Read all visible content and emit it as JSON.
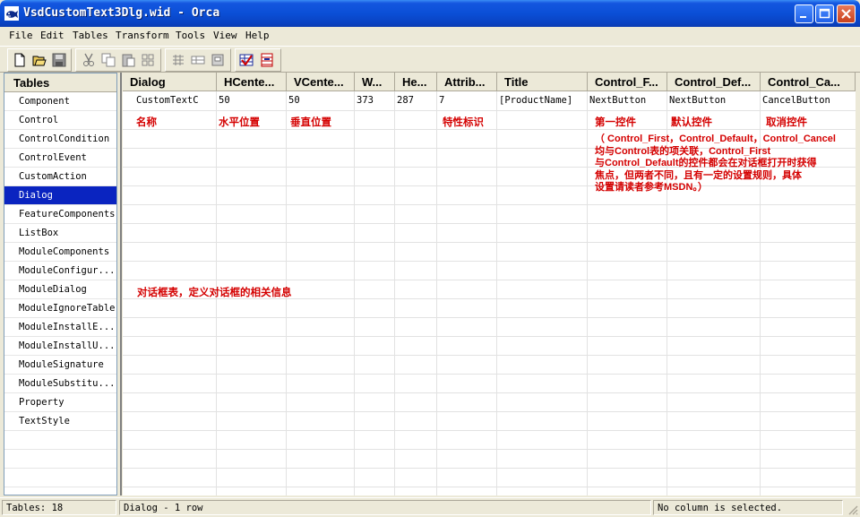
{
  "window": {
    "title": "VsdCustomText3Dlg.wid - Orca",
    "app_icon": "orca-whale-icon",
    "controls": [
      "minimize-icon",
      "maximize-icon",
      "close-icon"
    ]
  },
  "menu": {
    "items": [
      "File",
      "Edit",
      "Tables",
      "Transform",
      "Tools",
      "View",
      "Help"
    ]
  },
  "toolbar": {
    "icons": [
      "new-icon",
      "open-icon",
      "save-icon",
      "cut-icon",
      "copy-icon",
      "paste-icon",
      "find-icon",
      "add-row-icon",
      "drop-row-icon",
      "add-table-icon",
      "validate-icon",
      "merge-module-icon"
    ]
  },
  "sidebar": {
    "header": "Tables",
    "items": [
      "Component",
      "Control",
      "ControlCondition",
      "ControlEvent",
      "CustomAction",
      "Dialog",
      "FeatureComponents",
      "ListBox",
      "ModuleComponents",
      "ModuleConfigur...",
      "ModuleDialog",
      "ModuleIgnoreTable",
      "ModuleInstallE...",
      "ModuleInstallU...",
      "ModuleSignature",
      "ModuleSubstitu...",
      "Property",
      "TextStyle"
    ],
    "selected_index": 5,
    "selection_color": "#0a24c0"
  },
  "grid": {
    "columns": [
      "Dialog",
      "HCente...",
      "VCente...",
      "W...",
      "He...",
      "Attrib...",
      "Title",
      "Control_F...",
      "Control_Def...",
      "Control_Ca..."
    ],
    "rows": [
      [
        "CustomTextC",
        "50",
        "50",
        "373",
        "287",
        "7",
        "[ProductName]",
        "NextButton",
        "NextButton",
        "CancelButton"
      ]
    ],
    "annotations": {
      "dialog": "名称",
      "hcenter": "水平位置",
      "vcenter": "垂直位置",
      "attributes": "特性标识",
      "control_first": "第一控件",
      "control_default": "默认控件",
      "control_cancel": "取消控件",
      "note_lines": [
        "（ Control_First，Control_Default，Control_Cancel",
        "均与Control表的项关联，Control_First",
        "与Control_Default的控件都会在对话框打开时获得",
        "焦点，但两者不同，且有一定的设置规则，具体",
        "设置请读者参考MSDN。）"
      ],
      "table_description": "对话框表，定义对话框的相关信息"
    },
    "annotation_color": "#d40000"
  },
  "status": {
    "tables": "Tables: 18",
    "table_info": "Dialog - 1 row",
    "selection": "No column is selected."
  }
}
